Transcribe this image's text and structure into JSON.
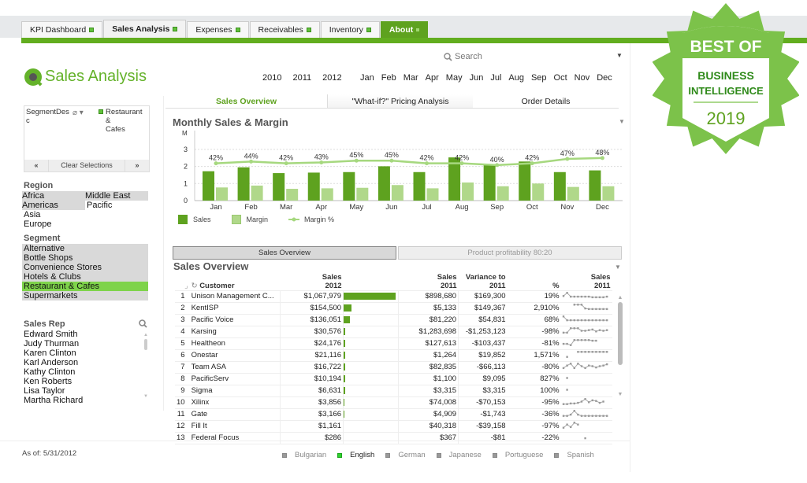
{
  "tabs": [
    {
      "label": "KPI Dashboard",
      "active": false
    },
    {
      "label": "Sales Analysis",
      "active": true
    },
    {
      "label": "Expenses",
      "active": false
    },
    {
      "label": "Receivables",
      "active": false
    },
    {
      "label": "Inventory",
      "active": false
    },
    {
      "label": "About",
      "active": false
    }
  ],
  "app": {
    "title": "Sales Analysis"
  },
  "search": {
    "placeholder": "Search"
  },
  "years": [
    "2010",
    "2011",
    "2012"
  ],
  "months": [
    "Jan",
    "Feb",
    "Mar",
    "Apr",
    "May",
    "Jun",
    "Jul",
    "Aug",
    "Sep",
    "Oct",
    "Nov",
    "Dec"
  ],
  "subtabs": [
    "Sales Overview",
    "\"What-if?\" Pricing Analysis",
    "Order Details"
  ],
  "current_selections": {
    "field": "SegmentDesc",
    "field_line1": "SegmentDes",
    "field_line2": "c",
    "value_line1": "Restaurant &",
    "value_line2": "Cafes",
    "clear_label": "Clear Selections",
    "prev": "«",
    "next": "»"
  },
  "region": {
    "title": "Region",
    "items": [
      "Africa",
      "Middle East",
      "Americas",
      "Pacific",
      "Asia",
      "Europe"
    ]
  },
  "segment": {
    "title": "Segment",
    "items": [
      "Alternative",
      "Bottle Shops",
      "Convenience Stores",
      "Hotels & Clubs",
      "Restaurant & Cafes",
      "Supermarkets"
    ],
    "selected": "Restaurant & Cafes"
  },
  "sales_rep": {
    "title": "Sales Rep",
    "items": [
      "Edward Smith",
      "Judy Thurman",
      "Karen Clinton",
      "Karl Anderson",
      "Kathy Clinton",
      "Ken Roberts",
      "Lisa Taylor",
      "Martha Richard"
    ]
  },
  "chart_data": {
    "type": "bar",
    "title": "Monthly Sales & Margin",
    "ylabel": "M",
    "ylim": [
      0,
      3
    ],
    "yticks": [
      "0",
      "1",
      "2",
      "3"
    ],
    "categories": [
      "Jan",
      "Feb",
      "Mar",
      "Apr",
      "May",
      "Jun",
      "Jul",
      "Aug",
      "Sep",
      "Oct",
      "Nov",
      "Dec"
    ],
    "series": [
      {
        "name": "Sales",
        "kind": "bar",
        "color": "#5ea21f",
        "values": [
          1.72,
          1.95,
          1.61,
          1.64,
          1.67,
          2.01,
          1.67,
          2.53,
          2.07,
          2.29,
          1.67,
          1.77
        ]
      },
      {
        "name": "Margin",
        "kind": "bar",
        "color": "#b0d88a",
        "values": [
          0.77,
          0.88,
          0.69,
          0.72,
          0.75,
          0.91,
          0.72,
          1.06,
          0.84,
          1.0,
          0.8,
          0.84
        ]
      },
      {
        "name": "Margin %",
        "kind": "line",
        "color": "#a6d87f",
        "values": [
          42,
          44,
          42,
          43,
          45,
          45,
          42,
          42,
          40,
          42,
          47,
          48
        ],
        "labels": [
          "42%",
          "44%",
          "42%",
          "43%",
          "45%",
          "45%",
          "42%",
          "42%",
          "40%",
          "42%",
          "47%",
          "48%"
        ]
      }
    ],
    "legend": [
      "Sales",
      "Margin",
      "Margin %"
    ],
    "legend_position": "bottom-left",
    "grid": true
  },
  "buttons": {
    "sales_overview": "Sales Overview",
    "product_profitability": "Product profitability 80:20"
  },
  "table": {
    "title": "Sales Overview",
    "headers": {
      "customer": "Customer",
      "sales2012_l1": "Sales",
      "sales2012_l2": "2012",
      "sales2011_l1": "Sales",
      "sales2011_l2": "2011",
      "var_l1": "Variance to",
      "var_l2": "2011",
      "pct": "%",
      "spark_l1": "Sales",
      "spark_l2": "2011"
    },
    "rows": [
      {
        "idx": "1",
        "customer": "Unison Management C...",
        "sales2012": "$1,067,979",
        "bar": 1.0,
        "sales2011": "$898,680",
        "variance": "$169,300",
        "pct": "19%",
        "spark": [
          0.4,
          0.9,
          0.3,
          0.3,
          0.3,
          0.3,
          0.3,
          0.3,
          0.2,
          0.2,
          0.2,
          0.2,
          0.3
        ]
      },
      {
        "idx": "2",
        "customer": "KentISP",
        "sales2012": "$154,500",
        "bar": 0.145,
        "sales2011": "$5,133",
        "variance": "$149,367",
        "pct": "2,910%",
        "spark": [
          null,
          null,
          null,
          0.9,
          0.9,
          0.9,
          0.3,
          0.2,
          0.2,
          0.2,
          0.2,
          0.2,
          0.2
        ]
      },
      {
        "idx": "3",
        "customer": "Pacific Voice",
        "sales2012": "$136,051",
        "bar": 0.127,
        "sales2011": "$81,220",
        "variance": "$54,831",
        "pct": "68%",
        "spark": [
          0.9,
          0.3,
          0.3,
          0.3,
          0.3,
          0.3,
          0.3,
          0.3,
          0.3,
          0.3,
          0.3,
          0.3,
          0.3
        ]
      },
      {
        "idx": "4",
        "customer": "Karsing",
        "sales2012": "$30,576",
        "bar": 0.029,
        "sales2011": "$1,283,698",
        "variance": "-$1,253,123",
        "pct": "-98%",
        "spark": [
          0.2,
          0.2,
          0.9,
          0.9,
          0.9,
          0.5,
          0.5,
          0.6,
          0.7,
          0.4,
          0.6,
          0.5,
          0.6
        ]
      },
      {
        "idx": "5",
        "customer": "Healtheon",
        "sales2012": "$24,176",
        "bar": 0.023,
        "sales2011": "$127,613",
        "variance": "-$103,437",
        "pct": "-81%",
        "spark": [
          0.3,
          0.3,
          0.1,
          0.9,
          0.9,
          0.9,
          0.9,
          0.9,
          0.8,
          0.8,
          null,
          null,
          null
        ]
      },
      {
        "idx": "6",
        "customer": "Onestar",
        "sales2012": "$21,116",
        "bar": 0.02,
        "sales2011": "$1,264",
        "variance": "$19,852",
        "pct": "1,571%",
        "spark": [
          null,
          0.1,
          null,
          null,
          0.9,
          0.9,
          0.9,
          0.9,
          0.9,
          0.9,
          0.9,
          0.9,
          0.9
        ]
      },
      {
        "idx": "7",
        "customer": "Team ASA",
        "sales2012": "$16,722",
        "bar": 0.016,
        "sales2011": "$82,835",
        "variance": "-$66,113",
        "pct": "-80%",
        "spark": [
          0.2,
          0.6,
          0.9,
          0.2,
          0.9,
          0.5,
          0.2,
          0.6,
          0.5,
          0.3,
          0.5,
          0.6,
          0.8
        ]
      },
      {
        "idx": "8",
        "customer": "PacificServ",
        "sales2012": "$10,194",
        "bar": 0.0095,
        "sales2011": "$1,100",
        "variance": "$9,095",
        "pct": "827%",
        "spark": [
          null,
          0.5,
          null,
          null,
          null,
          null,
          null,
          null,
          null,
          null,
          null,
          null,
          null
        ]
      },
      {
        "idx": "9",
        "customer": "Sigma",
        "sales2012": "$6,631",
        "bar": 0.006,
        "sales2011": "$3,315",
        "variance": "$3,315",
        "pct": "100%",
        "spark": [
          null,
          0.5,
          null,
          null,
          null,
          null,
          null,
          null,
          null,
          null,
          null,
          null,
          null
        ]
      },
      {
        "idx": "10",
        "customer": "Xilinx",
        "sales2012": "$3,856",
        "bar": 0.0036,
        "sales2011": "$74,008",
        "variance": "-$70,153",
        "pct": "-95%",
        "spark": [
          0.1,
          0.1,
          0.2,
          0.2,
          0.3,
          0.5,
          0.9,
          0.4,
          0.7,
          0.6,
          0.3,
          0.5,
          null
        ]
      },
      {
        "idx": "11",
        "customer": "Gate",
        "sales2012": "$3,166",
        "bar": 0.003,
        "sales2011": "$4,909",
        "variance": "-$1,743",
        "pct": "-36%",
        "spark": [
          0.1,
          0.1,
          0.3,
          0.9,
          0.3,
          0.1,
          0.1,
          0.1,
          0.1,
          0.1,
          0.1,
          0.1,
          0.1
        ]
      },
      {
        "idx": "12",
        "customer": "Fill It",
        "sales2012": "$1,161",
        "bar": 0.001,
        "sales2011": "$40,318",
        "variance": "-$39,158",
        "pct": "-97%",
        "spark": [
          0.1,
          0.6,
          0.2,
          0.9,
          0.6,
          null,
          null,
          null,
          null,
          null,
          null,
          null,
          null
        ]
      },
      {
        "idx": "13",
        "customer": "Federal Focus",
        "sales2012": "$286",
        "bar": 0.0003,
        "sales2011": "$367",
        "variance": "-$81",
        "pct": "-22%",
        "spark": [
          null,
          null,
          null,
          null,
          null,
          null,
          0.3,
          null,
          null,
          null,
          null,
          null,
          null
        ]
      }
    ]
  },
  "footer": {
    "as_of": "As of: 5/31/2012",
    "languages": [
      {
        "label": "Bulgarian",
        "active": false
      },
      {
        "label": "English",
        "active": true
      },
      {
        "label": "German",
        "active": false
      },
      {
        "label": "Japanese",
        "active": false
      },
      {
        "label": "Portuguese",
        "active": false
      },
      {
        "label": "Spanish",
        "active": false
      }
    ]
  },
  "badge": {
    "line1": "BEST OF",
    "line2": "BUSINESS",
    "line3": "INTELLIGENCE",
    "year": "2019"
  },
  "colors": {
    "brand_green": "#5ea21f",
    "light_green": "#b0d88a",
    "selected_green": "#7ed34a"
  }
}
